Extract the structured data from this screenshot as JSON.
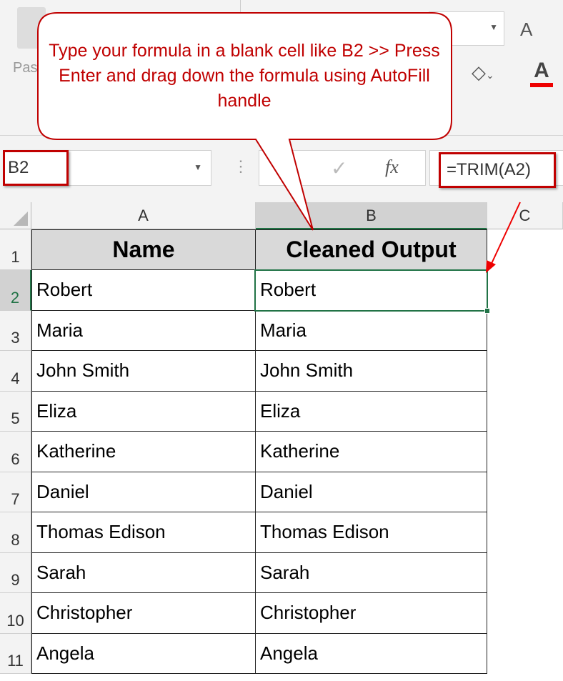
{
  "ribbon": {
    "paste_label": "Pas",
    "font_size_increase": "A",
    "font_color": "A"
  },
  "formula_bar": {
    "name_box": "B2",
    "fx": "fx",
    "formula": "=TRIM(A2)"
  },
  "columns": [
    "A",
    "B",
    "C"
  ],
  "rows": [
    {
      "num": "1",
      "a": "Name",
      "b": "Cleaned Output"
    },
    {
      "num": "2",
      "a": "Robert",
      "b": "Robert"
    },
    {
      "num": "3",
      "a": "Maria",
      "b": "Maria"
    },
    {
      "num": "4",
      "a": "John Smith",
      "b": "John Smith"
    },
    {
      "num": "5",
      "a": "Eliza",
      "b": "Eliza"
    },
    {
      "num": "6",
      "a": "Katherine",
      "b": "Katherine"
    },
    {
      "num": "7",
      "a": "Daniel",
      "b": "Daniel"
    },
    {
      "num": "8",
      "a": "Thomas Edison",
      "b": "Thomas Edison"
    },
    {
      "num": "9",
      "a": "Sarah",
      "b": "Sarah"
    },
    {
      "num": "10",
      "a": "Christopher",
      "b": "Christopher"
    },
    {
      "num": "11",
      "a": "Angela",
      "b": "Angela"
    }
  ],
  "callout": {
    "text": "Type your formula in a blank cell like B2 >> Press Enter and drag down the formula using AutoFill handle"
  },
  "colors": {
    "accent": "#c00000",
    "selection": "#217346"
  }
}
